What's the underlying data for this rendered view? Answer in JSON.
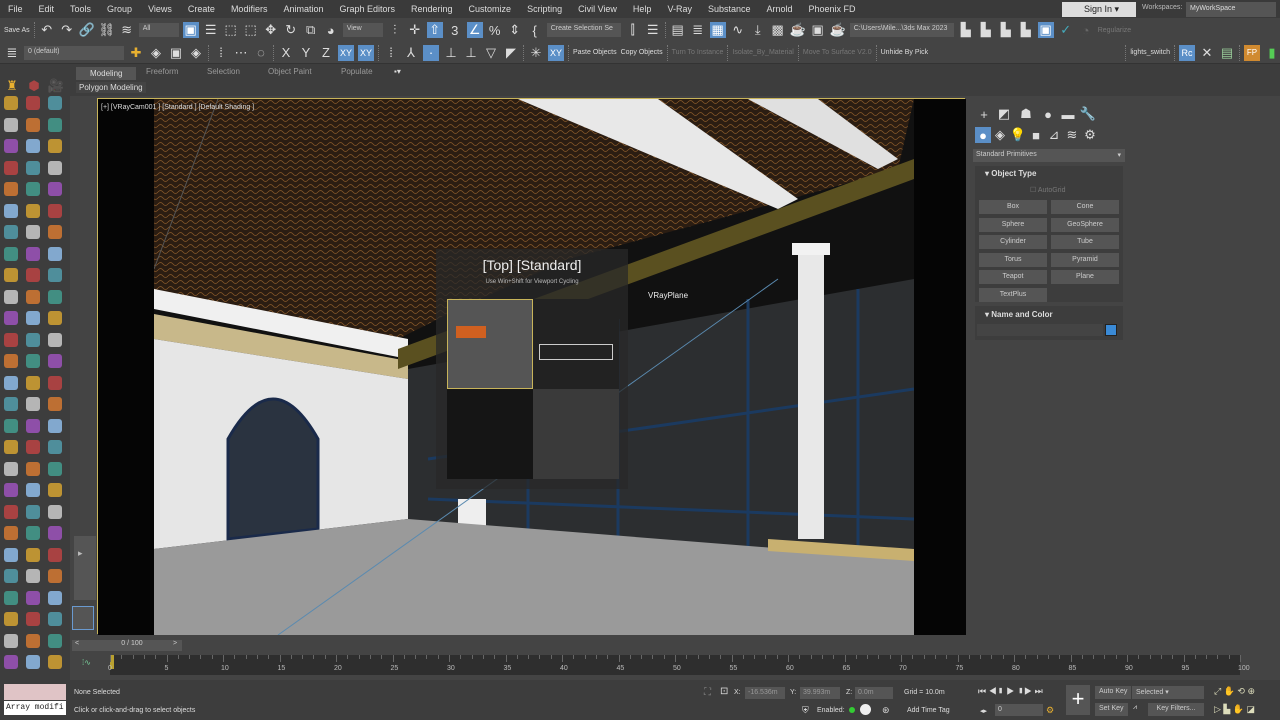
{
  "menu": [
    "File",
    "Edit",
    "Tools",
    "Group",
    "Views",
    "Create",
    "Modifiers",
    "Animation",
    "Graph Editors",
    "Rendering",
    "Customize",
    "Scripting",
    "Civil View",
    "Help",
    "V-Ray",
    "Substance",
    "Arnold",
    "Phoenix FD"
  ],
  "account": {
    "sign_in": "Sign In",
    "workspaces_label": "Workspaces:",
    "workspace": "MyWorkSpace"
  },
  "toolbar1": {
    "save_as": "Save As",
    "filter": "All",
    "ref_coord": "View",
    "selection_set": "Create Selection Se",
    "project_path": "C:\\Users\\Mile...\\3ds Max 2023",
    "regularize": "Regularize"
  },
  "toolbar2": {
    "layer": "0 (default)",
    "axes": [
      "X",
      "Y",
      "Z",
      "XY",
      "XY"
    ],
    "scripts": [
      {
        "label": "Paste Objects",
        "enabled": true
      },
      {
        "label": "Copy Objects",
        "enabled": true
      },
      {
        "label": "Turn To Instance",
        "enabled": false
      },
      {
        "label": "Isolate_By_Material",
        "enabled": false
      },
      {
        "label": "Move To Surface V2.0",
        "enabled": false
      },
      {
        "label": "Unhide By Pick",
        "enabled": true
      }
    ],
    "lights_switch": "lights_switch",
    "rc": "Rc",
    "fp": "FP"
  },
  "ribbon": {
    "tabs": [
      "Modeling",
      "Freeform",
      "Selection",
      "Object Paint",
      "Populate"
    ],
    "active": "Modeling",
    "panel": "Polygon Modeling"
  },
  "viewport": {
    "label": "[+] [VRayCam001 ] [Standard ] [Default Shading ]",
    "cycle_title": "[Top] [Standard]",
    "cycle_hint": "Use Win+Shift for Viewport Cycling",
    "object_label": "VRayPlane"
  },
  "command_panel": {
    "category": "Standard Primitives",
    "object_type": "Object Type",
    "autogrid": "AutoGrid",
    "buttons": [
      "Box",
      "Cone",
      "Sphere",
      "GeoSphere",
      "Cylinder",
      "Tube",
      "Torus",
      "Pyramid",
      "Teapot",
      "Plane",
      "TextPlus"
    ],
    "name_and_color": "Name and Color",
    "color": "#3a8ad6"
  },
  "timeline": {
    "frame": "0 / 100",
    "ticks": [
      "0",
      "5",
      "10",
      "15",
      "20",
      "25",
      "30",
      "35",
      "40",
      "45",
      "50",
      "55",
      "60",
      "65",
      "70",
      "75",
      "80",
      "85",
      "90",
      "95",
      "100"
    ]
  },
  "status": {
    "maxscript": "Array modifi",
    "selection": "None Selected",
    "prompt": "Click or click-and-drag to select objects",
    "x": "-16.536m",
    "y": "39.993m",
    "z": "0.0m",
    "x_label": "X:",
    "y_label": "Y:",
    "z_label": "Z:",
    "grid": "Grid = 10.0m",
    "enabled": "Enabled:",
    "add_time_tag": "Add Time Tag",
    "current_frame": "0",
    "auto_key": "Auto Key",
    "set_key": "Set Key",
    "key_mode": "Selected",
    "key_filters": "Key Filters..."
  }
}
